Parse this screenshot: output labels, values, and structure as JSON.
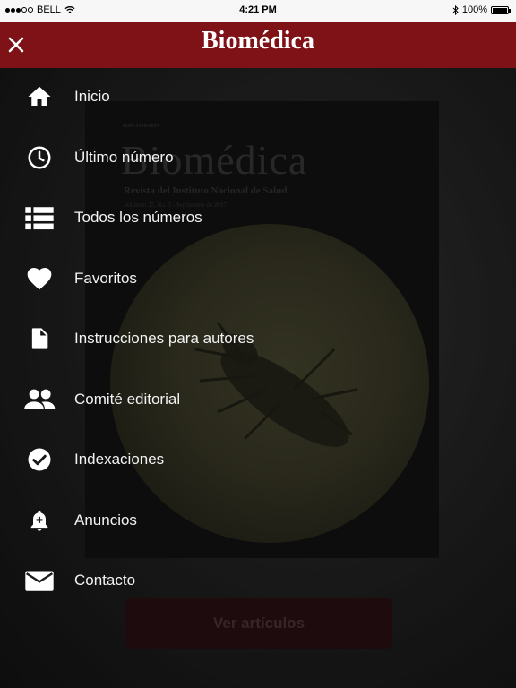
{
  "status_bar": {
    "carrier": "BELL",
    "time": "4:21 PM",
    "battery": "100%"
  },
  "header": {
    "title": "Biomédica"
  },
  "cover": {
    "issn": "ISSN 0120-4157",
    "title": "Biomédica",
    "subtitle": "Revista del Instituto Nacional de Salud",
    "volume": "Volumen 37, No. 3 - Septiembre de 2017"
  },
  "cta": {
    "label": "Ver artículos"
  },
  "menu": {
    "items": [
      {
        "label": "Inicio",
        "icon": "home-icon"
      },
      {
        "label": "Último número",
        "icon": "clock-icon"
      },
      {
        "label": "Todos los números",
        "icon": "list-icon"
      },
      {
        "label": "Favoritos",
        "icon": "heart-icon"
      },
      {
        "label": "Instrucciones para autores",
        "icon": "document-icon"
      },
      {
        "label": "Comité editorial",
        "icon": "people-icon"
      },
      {
        "label": "Indexaciones",
        "icon": "check-circle-icon"
      },
      {
        "label": "Anuncios",
        "icon": "bell-plus-icon"
      },
      {
        "label": "Contacto",
        "icon": "mail-icon"
      }
    ]
  },
  "colors": {
    "header_bg": "#7f1217",
    "text": "#f2f2f2"
  }
}
